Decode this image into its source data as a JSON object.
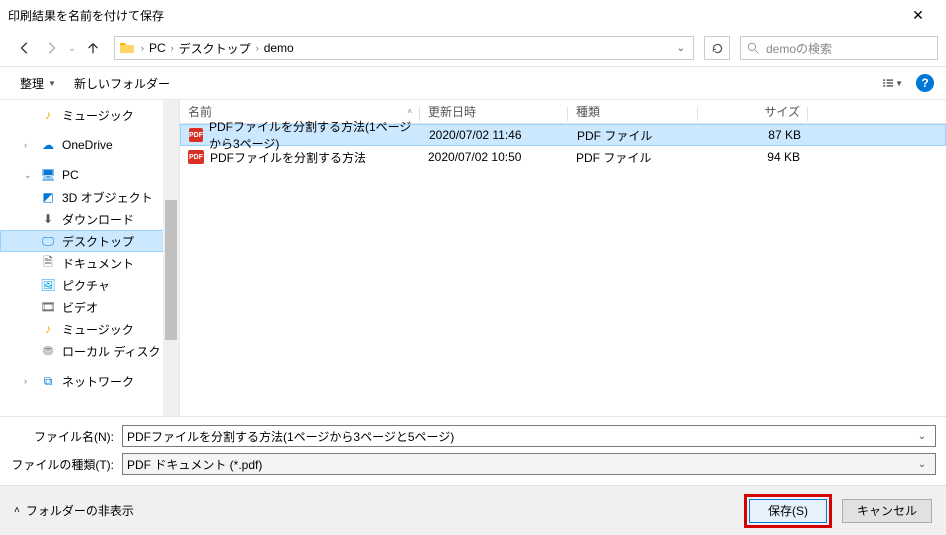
{
  "window": {
    "title": "印刷結果を名前を付けて保存"
  },
  "nav": {
    "path": [
      "PC",
      "デスクトップ",
      "demo"
    ]
  },
  "search": {
    "placeholder": "demoの検索"
  },
  "toolbar": {
    "organize": "整理",
    "new_folder": "新しいフォルダー"
  },
  "tree": {
    "music": "ミュージック",
    "onedrive": "OneDrive",
    "pc": "PC",
    "obj3d": "3D オブジェクト",
    "downloads": "ダウンロード",
    "desktop": "デスクトップ",
    "documents": "ドキュメント",
    "pictures": "ピクチャ",
    "videos": "ビデオ",
    "music2": "ミュージック",
    "disk": "ローカル ディスク (C",
    "network": "ネットワーク"
  },
  "columns": {
    "name": "名前",
    "date": "更新日時",
    "type": "種類",
    "size": "サイズ"
  },
  "files": [
    {
      "name": "PDFファイルを分割する方法(1ページから3ページ)",
      "date": "2020/07/02 11:46",
      "type": "PDF ファイル",
      "size": "87 KB",
      "selected": true
    },
    {
      "name": "PDFファイルを分割する方法",
      "date": "2020/07/02 10:50",
      "type": "PDF ファイル",
      "size": "94 KB",
      "selected": false
    }
  ],
  "inputs": {
    "filename_label": "ファイル名(N):",
    "filename_value": "PDFファイルを分割する方法(1ページから3ページと5ページ)",
    "filetype_label": "ファイルの種類(T):",
    "filetype_value": "PDF ドキュメント (*.pdf)"
  },
  "footer": {
    "hide_folders": "フォルダーの非表示",
    "save": "保存(S)",
    "cancel": "キャンセル"
  }
}
